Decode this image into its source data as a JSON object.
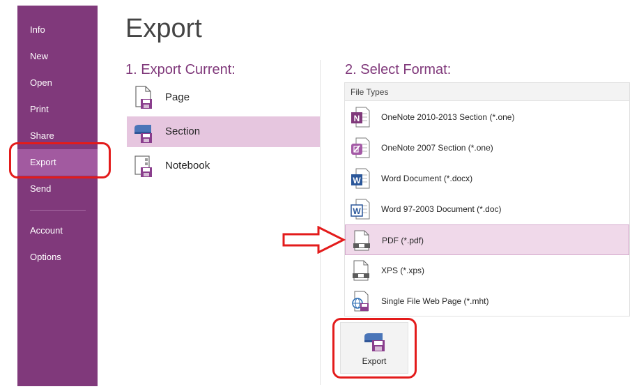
{
  "sidebar": {
    "items": [
      {
        "label": "Info"
      },
      {
        "label": "New"
      },
      {
        "label": "Open"
      },
      {
        "label": "Print"
      },
      {
        "label": "Share"
      },
      {
        "label": "Export"
      },
      {
        "label": "Send"
      },
      {
        "label": "Account"
      },
      {
        "label": "Options"
      }
    ],
    "active": "Export"
  },
  "page": {
    "title": "Export"
  },
  "export_current": {
    "heading": "1. Export Current:",
    "options": [
      {
        "label": "Page",
        "icon": "page-export-icon"
      },
      {
        "label": "Section",
        "icon": "section-export-icon"
      },
      {
        "label": "Notebook",
        "icon": "notebook-export-icon"
      }
    ],
    "selected": "Section"
  },
  "select_format": {
    "heading": "2. Select Format:",
    "list_header": "File Types",
    "file_types": [
      {
        "label": "OneNote 2010-2013 Section (*.one)",
        "icon": "onenote-icon"
      },
      {
        "label": "OneNote 2007 Section (*.one)",
        "icon": "onenote-2007-icon"
      },
      {
        "label": "Word Document (*.docx)",
        "icon": "word-icon"
      },
      {
        "label": "Word 97-2003 Document (*.doc)",
        "icon": "word-97-icon"
      },
      {
        "label": "PDF (*.pdf)",
        "icon": "pdf-icon"
      },
      {
        "label": "XPS (*.xps)",
        "icon": "xps-icon"
      },
      {
        "label": "Single File Web Page (*.mht)",
        "icon": "web-page-icon"
      }
    ],
    "selected": "PDF (*.pdf)"
  },
  "export_button": {
    "label": "Export",
    "icon": "export-icon"
  },
  "colors": {
    "sidebar": "#80397b",
    "sidebar_active": "#a25aa0",
    "accent": "#80397b",
    "selection": "#e6c6df",
    "highlight": "#e31b1b"
  }
}
